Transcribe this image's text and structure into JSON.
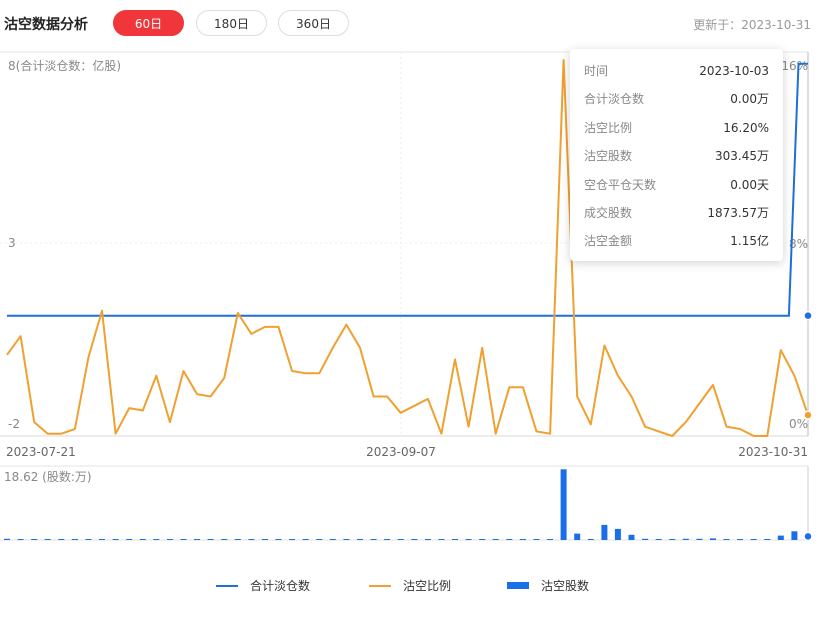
{
  "header": {
    "title": "沽空数据分析",
    "tabs": [
      {
        "label": "60日",
        "active": true
      },
      {
        "label": "180日",
        "active": false
      },
      {
        "label": "360日",
        "active": false
      }
    ],
    "updated": "更新于：2023-10-31"
  },
  "tooltip": {
    "rows": [
      {
        "key": "时间",
        "value": "2023-10-03"
      },
      {
        "key": "合计淡仓数",
        "value": "0.00万"
      },
      {
        "key": "沽空比例",
        "value": "16.20%"
      },
      {
        "key": "沽空股数",
        "value": "303.45万"
      },
      {
        "key": "空仓平仓天数",
        "value": "0.00天"
      },
      {
        "key": "成交股数",
        "value": "1873.57万"
      },
      {
        "key": "沽空金额",
        "value": "1.15亿"
      }
    ]
  },
  "legend": [
    {
      "label": "合计淡仓数",
      "color": "#1e6fd9",
      "kind": "line"
    },
    {
      "label": "沽空比例",
      "color": "#f0a030",
      "kind": "line"
    },
    {
      "label": "沽空股数",
      "color": "#1a6fe8",
      "kind": "bar"
    }
  ],
  "chart_data": [
    {
      "type": "line",
      "x_ticks": [
        "2023-07-21",
        "2023-09-07",
        "2023-10-31"
      ],
      "left_axis": {
        "label": "(合计淡仓数：亿股)",
        "ticks": [
          "8",
          "3",
          "-2"
        ],
        "range": [
          -2,
          8
        ]
      },
      "right_axis": {
        "ticks": [
          "16%",
          "8%",
          "0%"
        ],
        "range": [
          0,
          16.2
        ]
      },
      "grid": true,
      "crosshair_index": 59,
      "series": [
        {
          "name": "合计淡仓数",
          "color": "#1e6fd9",
          "axis": "left",
          "values": [
            1.2,
            1.2,
            1.2,
            1.2,
            1.2,
            1.2,
            1.2,
            1.2,
            1.2,
            1.2,
            1.2,
            1.2,
            1.2,
            1.2,
            1.2,
            1.2,
            1.2,
            1.2,
            1.2,
            1.2,
            1.2,
            1.2,
            1.2,
            1.2,
            1.2,
            1.2,
            1.2,
            1.2,
            1.2,
            1.2,
            1.2,
            1.2,
            1.2,
            1.2,
            1.2,
            1.2,
            1.2,
            1.2,
            1.2,
            1.2,
            1.2,
            1.2,
            1.2,
            1.2,
            1.2,
            1.2,
            1.2,
            1.2,
            1.2,
            1.2,
            1.2,
            1.2,
            1.2,
            1.2,
            1.2,
            1.2,
            1.2,
            1.2,
            1.2,
            1.2,
            1.2,
            1.2,
            1.2,
            1.2,
            1.2,
            1.2,
            1.2,
            1.2,
            1.2,
            1.2,
            1.2,
            1.2,
            1.2,
            1.2,
            1.2,
            1.2,
            1.2,
            1.2,
            1.2,
            1.2,
            1.2,
            1.2,
            1.2,
            7.9,
            7.9
          ]
        },
        {
          "name": "沽空比例",
          "color": "#f0a030",
          "axis": "right",
          "values": [
            3.5,
            4.3,
            0.6,
            0.1,
            0.1,
            0.3,
            3.4,
            5.4,
            0.1,
            1.2,
            1.1,
            2.6,
            0.6,
            2.8,
            1.8,
            1.7,
            2.5,
            5.3,
            4.4,
            4.7,
            4.7,
            2.8,
            2.7,
            2.7,
            3.8,
            4.8,
            3.8,
            1.7,
            1.7,
            1.0,
            1.3,
            1.6,
            0.1,
            3.3,
            0.4,
            3.8,
            0.1,
            2.1,
            2.1,
            0.2,
            0.1,
            16.2,
            1.7,
            0.5,
            3.9,
            2.6,
            1.7,
            0.4,
            0.2,
            0.0,
            0.6,
            1.4,
            2.2,
            0.4,
            0.3,
            0.0,
            0.0,
            3.7,
            2.6,
            0.9
          ]
        }
      ]
    },
    {
      "type": "bar",
      "axis_label": "18.62 (股数:万)",
      "range": [
        0,
        18.62
      ],
      "series": [
        {
          "name": "沽空股数",
          "color": "#1a6fe8",
          "values": [
            0.3,
            0.2,
            0.1,
            0.1,
            0.1,
            0.1,
            0.1,
            0.1,
            0.2,
            0.1,
            0.1,
            0.1,
            0.1,
            0.1,
            0.1,
            0.1,
            0.1,
            0.1,
            0.1,
            0.1,
            0.1,
            0.1,
            0.1,
            0.1,
            0.1,
            0.1,
            0.1,
            0.1,
            0.1,
            0.1,
            0.1,
            0.1,
            0.1,
            0.1,
            0.1,
            0.1,
            0.1,
            0.1,
            0.1,
            0.1,
            0.1,
            17.8,
            1.6,
            0.1,
            3.8,
            2.8,
            1.3,
            0.3,
            0.1,
            0.1,
            0.3,
            0.3,
            0.4,
            0.1,
            0.1,
            0.1,
            0.1,
            1.1,
            2.2,
            0.9
          ]
        }
      ]
    }
  ]
}
